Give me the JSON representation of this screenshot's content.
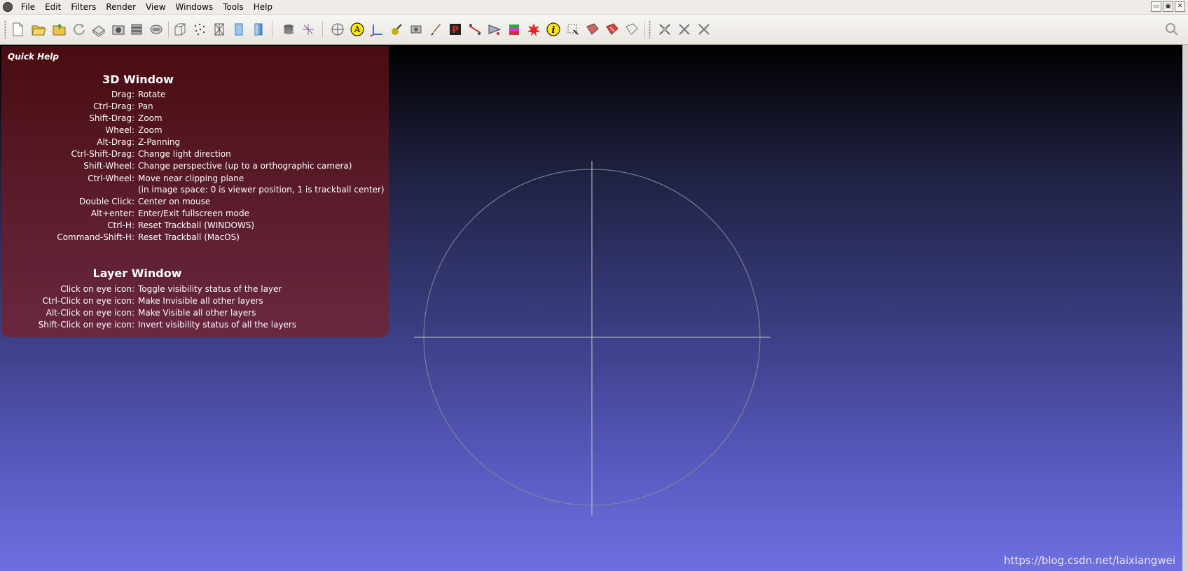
{
  "menubar": {
    "items": [
      {
        "label": "File"
      },
      {
        "label": "Edit"
      },
      {
        "label": "Filters"
      },
      {
        "label": "Render"
      },
      {
        "label": "View"
      },
      {
        "label": "Windows"
      },
      {
        "label": "Tools"
      },
      {
        "label": "Help"
      }
    ]
  },
  "toolbar": {
    "icons": [
      "new-project-icon",
      "open-project-icon",
      "import-mesh-icon",
      "reload-icon",
      "export-mesh-icon",
      "snapshot-icon",
      "layers-icon",
      "save-snapshot-icon",
      "bbox-icon",
      "points-icon",
      "wireframe-icon",
      "flat-shading-icon",
      "smooth-shading-icon",
      "layer-dialog-icon",
      "axis-icon",
      "trackball-icon",
      "annotation-icon",
      "draw-axis-icon",
      "paint-icon",
      "align-icon",
      "brush-icon",
      "pickpoints-icon",
      "measure-icon",
      "select-faces-icon",
      "color-icon",
      "georef-icon",
      "info-icon",
      "select-vertices-icon",
      "select-region-icon",
      "select-connected-icon",
      "select-none-icon",
      "edit-tool-1-icon",
      "edit-tool-2-icon",
      "edit-tool-3-icon",
      "search-icon"
    ]
  },
  "quick_help": {
    "title": "Quick Help",
    "window3d": {
      "heading": "3D Window",
      "rows": [
        {
          "key": "Drag:",
          "value": "Rotate"
        },
        {
          "key": "Ctrl-Drag:",
          "value": "Pan"
        },
        {
          "key": "Shift-Drag:",
          "value": "Zoom"
        },
        {
          "key": "Wheel:",
          "value": "Zoom"
        },
        {
          "key": "Alt-Drag:",
          "value": "Z-Panning"
        },
        {
          "key": "Ctrl-Shift-Drag:",
          "value": "Change light direction"
        },
        {
          "key": "Shift-Wheel:",
          "value": "Change perspective (up to a orthographic camera)"
        },
        {
          "key": "Ctrl-Wheel:",
          "value": "Move near clipping plane"
        },
        {
          "key": "",
          "value": "(in image space: 0 is viewer position, 1 is trackball center)"
        },
        {
          "key": "Double Click:",
          "value": "Center on mouse"
        },
        {
          "key": "Alt+enter:",
          "value": "Enter/Exit fullscreen mode"
        },
        {
          "key": "Ctrl-H:",
          "value": "Reset Trackball (WINDOWS)"
        },
        {
          "key": "Command-Shift-H:",
          "value": "Reset Trackball (MacOS)"
        }
      ]
    },
    "layer": {
      "heading": "Layer Window",
      "rows": [
        {
          "key": "Click on eye icon:",
          "value": "Toggle visibility status of the layer"
        },
        {
          "key": "Ctrl-Click on eye icon:",
          "value": "Make Invisible all other layers"
        },
        {
          "key": "Alt-Click on eye icon:",
          "value": "Make Visible all other layers"
        },
        {
          "key": "Shift-Click on eye icon:",
          "value": "Invert visibility status of all the layers"
        }
      ]
    }
  },
  "watermark": "https://blog.csdn.net/laixiangwei"
}
